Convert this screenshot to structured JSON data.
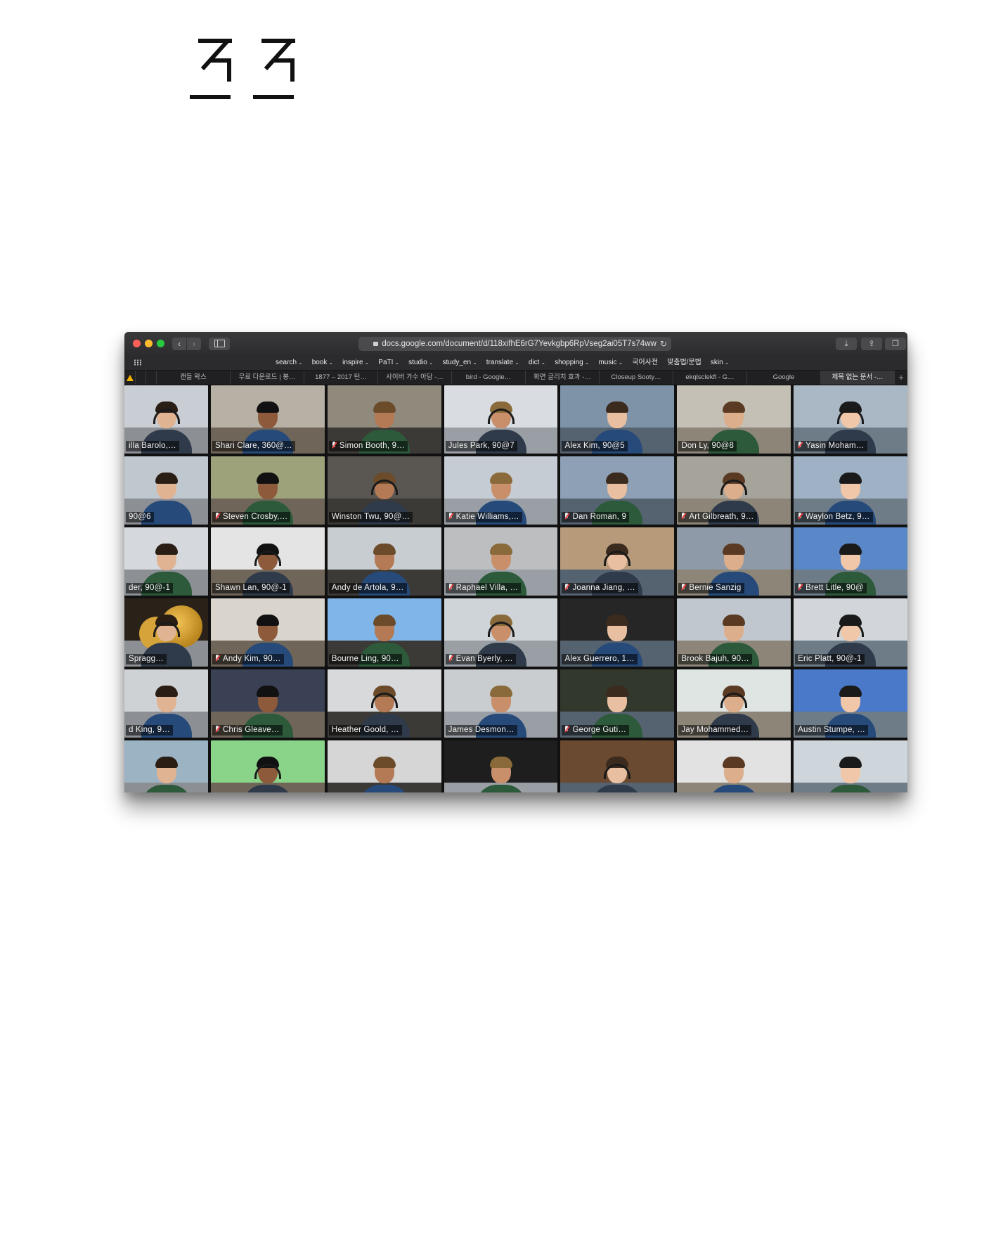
{
  "logo": {
    "alt": "ㅈㅈ"
  },
  "browser": {
    "address": "docs.google.com/document/d/118xifhE6rG7Yevkgbp6RpVseg2ai05T7s74ww",
    "bookmarks": [
      {
        "label": "search"
      },
      {
        "label": "book"
      },
      {
        "label": "inspire"
      },
      {
        "label": "PaTI"
      },
      {
        "label": "studio"
      },
      {
        "label": "study_en"
      },
      {
        "label": "translate"
      },
      {
        "label": "dict"
      },
      {
        "label": "shopping"
      },
      {
        "label": "music"
      },
      {
        "label": "국어사전",
        "plain": true
      },
      {
        "label": "맞춤법/문법",
        "plain": true
      },
      {
        "label": "skin"
      }
    ],
    "tabs": [
      "캔들 왁스",
      "무료 다운로드 | 봉…",
      "1877 – 2017 턴…",
      "사이버 가수 아담 -…",
      "bird - Google…",
      "화면 글리치 효과 -…",
      "Closeup Sooty…",
      "ekqlsclekfl - G…",
      "Google",
      "제목 없는 문서 -…"
    ],
    "active_tab_index": 9
  },
  "participants": [
    {
      "name": "illa Barolo,…",
      "muted": false
    },
    {
      "name": "Shari Clare, 360@…",
      "muted": false
    },
    {
      "name": "Simon Booth, 9…",
      "muted": true
    },
    {
      "name": "Jules Park, 90@7",
      "muted": false
    },
    {
      "name": "Alex Kim, 90@5",
      "muted": false
    },
    {
      "name": "Don Ly, 90@8",
      "muted": false,
      "speaking": true
    },
    {
      "name": "Yasin Moham…",
      "muted": true
    },
    {
      "name": "90@6",
      "muted": false
    },
    {
      "name": "Steven Crosby,…",
      "muted": true
    },
    {
      "name": "Winston Twu, 90@…",
      "muted": false
    },
    {
      "name": "Katie Williams,…",
      "muted": true
    },
    {
      "name": "Dan Roman, 9",
      "muted": true
    },
    {
      "name": "Art Gilbreath, 9…",
      "muted": true
    },
    {
      "name": "Waylon Betz, 9…",
      "muted": true
    },
    {
      "name": "der, 90@-1",
      "muted": false
    },
    {
      "name": "Shawn Lan, 90@-1",
      "muted": false
    },
    {
      "name": "Andy de Artola, 9…",
      "muted": false
    },
    {
      "name": "Raphael Villa, …",
      "muted": true
    },
    {
      "name": "Joanna Jiang, …",
      "muted": true
    },
    {
      "name": "Bernie Sanzig",
      "muted": true
    },
    {
      "name": "Brett Litle, 90@",
      "muted": true
    },
    {
      "name": "Spragg…",
      "muted": false
    },
    {
      "name": "Andy Kim, 90…",
      "muted": true
    },
    {
      "name": "Bourne Ling, 90…",
      "muted": false
    },
    {
      "name": "Evan Byerly, …",
      "muted": true
    },
    {
      "name": "Alex Guerrero, 1…",
      "muted": false
    },
    {
      "name": "Brook Bajuh, 90…",
      "muted": false
    },
    {
      "name": "Eric Platt, 90@-1",
      "muted": false
    },
    {
      "name": "d King, 9…",
      "muted": false
    },
    {
      "name": "Chris Gleave…",
      "muted": true
    },
    {
      "name": "Heather Goold, …",
      "muted": false
    },
    {
      "name": "James Desmon…",
      "muted": false
    },
    {
      "name": "George Guti…",
      "muted": true
    },
    {
      "name": "Jay Mohammed…",
      "muted": false
    },
    {
      "name": "Austin Stumpe, …",
      "muted": false
    },
    {
      "name": "",
      "muted": false
    },
    {
      "name": "",
      "muted": false
    },
    {
      "name": "",
      "muted": false
    },
    {
      "name": "",
      "muted": false
    },
    {
      "name": "",
      "muted": false
    },
    {
      "name": "",
      "muted": false
    },
    {
      "name": "",
      "muted": false
    }
  ],
  "colors": {
    "speaking_outline": "#c7e12b",
    "mute_slash": "#e43c3c",
    "window_bg": "#1c1c1e"
  }
}
